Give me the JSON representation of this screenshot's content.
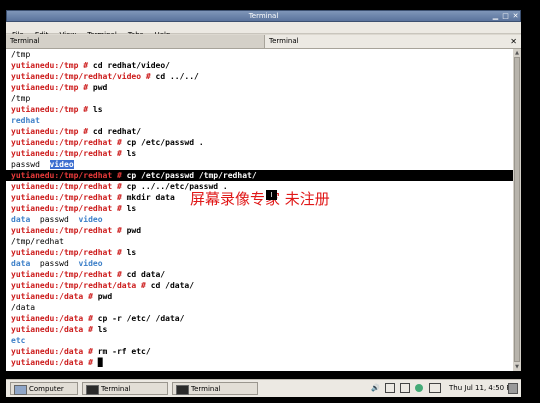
{
  "window": {
    "title": "Terminal"
  },
  "menu": [
    "File",
    "Edit",
    "View",
    "Terminal",
    "Tabs",
    "Help"
  ],
  "tabs": [
    "Terminal",
    "Terminal"
  ],
  "terminal": {
    "lines": [
      [
        {
          "t": "/tmp",
          "s": "o"
        }
      ],
      [
        {
          "t": "yutianedu:/tmp # ",
          "s": "p"
        },
        {
          "t": "cd redhat/video/",
          "s": "c"
        }
      ],
      [
        {
          "t": "yutianedu:/tmp/redhat/video # ",
          "s": "p"
        },
        {
          "t": "cd ../../",
          "s": "c"
        }
      ],
      [
        {
          "t": "yutianedu:/tmp # ",
          "s": "p"
        },
        {
          "t": "pwd",
          "s": "c"
        }
      ],
      [
        {
          "t": "/tmp",
          "s": "o"
        }
      ],
      [
        {
          "t": "yutianedu:/tmp # ",
          "s": "p"
        },
        {
          "t": "ls",
          "s": "c"
        }
      ],
      [
        {
          "t": "redhat",
          "s": "b"
        }
      ],
      [
        {
          "t": "yutianedu:/tmp # ",
          "s": "p"
        },
        {
          "t": "cd redhat/",
          "s": "c"
        }
      ],
      [
        {
          "t": "yutianedu:/tmp/redhat # ",
          "s": "p"
        },
        {
          "t": "cp /etc/passwd .",
          "s": "c"
        }
      ],
      [
        {
          "t": "yutianedu:/tmp/redhat # ",
          "s": "p"
        },
        {
          "t": "ls",
          "s": "c"
        }
      ],
      [
        {
          "t": "passwd",
          "s": "sel"
        },
        {
          "t": "  ",
          "s": "sel"
        },
        {
          "t": "video",
          "s": "selb"
        }
      ],
      [
        {
          "t": "yutianedu:/tmp/redhat # ",
          "s": "p"
        },
        {
          "t": "cp /etc/passwd /tmp/redhat/",
          "s": "c"
        }
      ],
      [
        {
          "t": "yutianedu:/tmp/redhat # ",
          "s": "p"
        },
        {
          "t": "cp ../../etc/passwd .",
          "s": "c"
        }
      ],
      [
        {
          "t": "yutianedu:/tmp/redhat # ",
          "s": "p"
        },
        {
          "t": "mkdir data",
          "s": "c"
        }
      ],
      [
        {
          "t": "yutianedu:/tmp/redhat # ",
          "s": "p"
        },
        {
          "t": "ls",
          "s": "c"
        }
      ],
      [
        {
          "t": "data",
          "s": "b"
        },
        {
          "t": "  passwd  ",
          "s": "o"
        },
        {
          "t": "video",
          "s": "b"
        }
      ],
      [
        {
          "t": "yutianedu:/tmp/redhat # ",
          "s": "p"
        },
        {
          "t": "pwd",
          "s": "c"
        }
      ],
      [
        {
          "t": "/tmp/redhat",
          "s": "o"
        }
      ],
      [
        {
          "t": "yutianedu:/tmp/redhat # ",
          "s": "p"
        },
        {
          "t": "ls",
          "s": "c"
        }
      ],
      [
        {
          "t": "data",
          "s": "b"
        },
        {
          "t": "  passwd  ",
          "s": "o"
        },
        {
          "t": "video",
          "s": "b"
        }
      ],
      [
        {
          "t": "yutianedu:/tmp/redhat # ",
          "s": "p"
        },
        {
          "t": "cd data/",
          "s": "c"
        }
      ],
      [
        {
          "t": "yutianedu:/tmp/redhat/data # ",
          "s": "p"
        },
        {
          "t": "cd /data/",
          "s": "c"
        }
      ],
      [
        {
          "t": "yutianedu:/data # ",
          "s": "p"
        },
        {
          "t": "pwd",
          "s": "c"
        }
      ],
      [
        {
          "t": "/data",
          "s": "o"
        }
      ],
      [
        {
          "t": "yutianedu:/data # ",
          "s": "p"
        },
        {
          "t": "cp -r /etc/ /data/",
          "s": "c"
        }
      ],
      [
        {
          "t": "yutianedu:/data # ",
          "s": "p"
        },
        {
          "t": "ls",
          "s": "c"
        }
      ],
      [
        {
          "t": "etc",
          "s": "b"
        }
      ],
      [
        {
          "t": "yutianedu:/data # ",
          "s": "p"
        },
        {
          "t": "rm -rf etc/",
          "s": "c"
        }
      ],
      [
        {
          "t": "yutianedu:/data # ",
          "s": "p"
        },
        {
          "t": "█",
          "s": "c"
        }
      ]
    ],
    "highlight_line": 11
  },
  "watermark": {
    "text": "屏幕录像专家  未注册",
    "icon_text": "I"
  },
  "taskbar": {
    "buttons": [
      "Computer",
      "Terminal",
      "Terminal"
    ],
    "clock": "Thu Jul 11,  4:50 PM"
  }
}
